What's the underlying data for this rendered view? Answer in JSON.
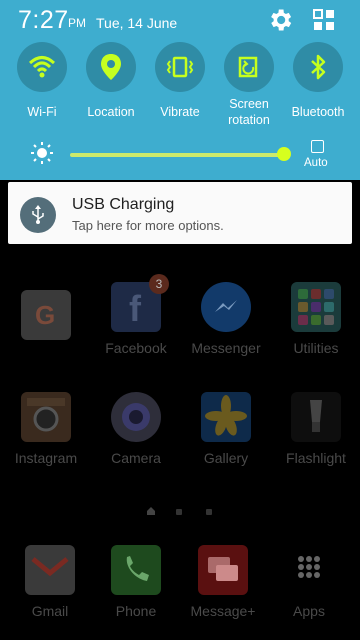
{
  "status": {
    "time": "7:27",
    "ampm": "PM",
    "date": "Tue, 14 June"
  },
  "quick_settings": [
    {
      "label": "Wi-Fi",
      "icon": "wifi-icon"
    },
    {
      "label": "Location",
      "icon": "location-icon"
    },
    {
      "label": "Vibrate",
      "icon": "vibrate-icon"
    },
    {
      "label": "Screen\nrotation",
      "icon": "rotation-icon"
    },
    {
      "label": "Bluetooth",
      "icon": "bluetooth-icon"
    }
  ],
  "brightness": {
    "level": 0.98,
    "auto_label": "Auto"
  },
  "notification": {
    "title": "USB Charging",
    "subtitle": "Tap here for more options.",
    "icon": "usb-icon"
  },
  "apps": [
    {
      "label": "",
      "icon": "google-icon"
    },
    {
      "label": "Facebook",
      "icon": "facebook-icon",
      "badge": "3"
    },
    {
      "label": "Messenger",
      "icon": "messenger-icon"
    },
    {
      "label": "Utilities",
      "icon": "utilities-folder-icon"
    },
    {
      "label": "Instagram",
      "icon": "instagram-icon"
    },
    {
      "label": "Camera",
      "icon": "camera-icon"
    },
    {
      "label": "Gallery",
      "icon": "gallery-icon"
    },
    {
      "label": "Flashlight",
      "icon": "flashlight-icon"
    }
  ],
  "dock": [
    {
      "label": "Gmail",
      "icon": "gmail-icon"
    },
    {
      "label": "Phone",
      "icon": "phone-icon"
    },
    {
      "label": "Message+",
      "icon": "message-plus-icon"
    },
    {
      "label": "Apps",
      "icon": "apps-grid-icon"
    }
  ],
  "colors": {
    "accent": "#3eadcf",
    "toggle_on": "#c6ff1f"
  }
}
